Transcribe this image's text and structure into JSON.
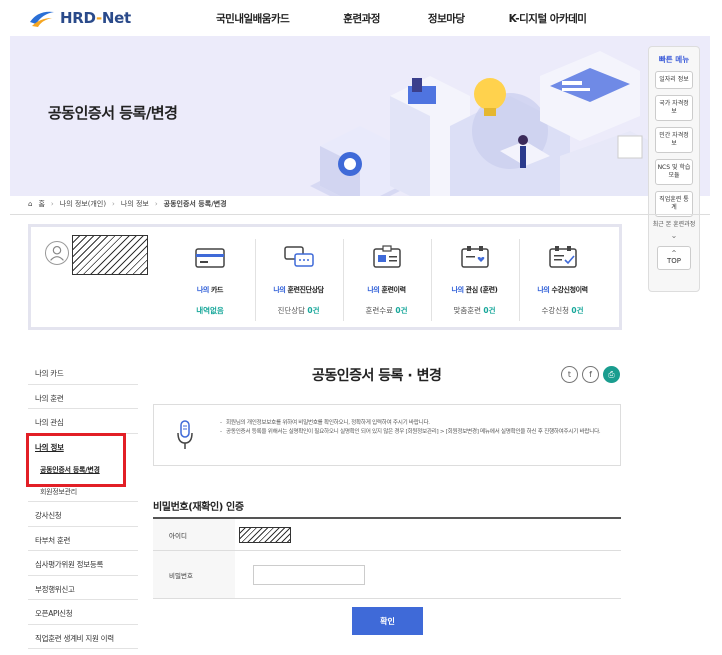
{
  "header": {
    "logo_main": "HRD",
    "logo_dash": "-",
    "logo_sub": "Net",
    "nav": [
      "국민내일배움카드",
      "훈련과정",
      "정보마당",
      "K-디지털 아카데미"
    ]
  },
  "hero": {
    "title": "공동인증서 등록/변경"
  },
  "quick_menu": {
    "title": "빠른 메뉴",
    "buttons": [
      "일자리 정보",
      "국가 자격정보",
      "민간 자격정보",
      "NCS 및 학습모듈",
      "직업훈련 통계"
    ],
    "recent": "최근 본 훈련과정",
    "top": "TOP"
  },
  "breadcrumb": [
    "홈",
    "나의 정보(개인)",
    "나의 정보",
    "공동인증서 등록/변경"
  ],
  "summary": {
    "items": [
      {
        "label_b": "나의",
        "label": " 카드",
        "value_plain": "내역없음"
      },
      {
        "label_b": "나의",
        "label": " 훈련진단상담",
        "value_text": "진단상담 ",
        "value_num": "0건"
      },
      {
        "label_b": "나의",
        "label": " 훈련이력",
        "value_text": "훈련수료 ",
        "value_num": "0건"
      },
      {
        "label_b": "나의",
        "label": " 관심 (훈련)",
        "value_text": "맞춤훈련 ",
        "value_num": "0건"
      },
      {
        "label_b": "나의",
        "label": " 수강신청이력",
        "value_text": "수강신청 ",
        "value_num": "0건"
      }
    ]
  },
  "side_menu": {
    "items_top": [
      "나의 카드",
      "나의 훈련",
      "나의 관심"
    ],
    "active": "나의 정보",
    "sub_on": "공동인증서 등록/변경",
    "sub_off": "회원정보관리",
    "items_bottom": [
      "강사신청",
      "타부처 훈련",
      "심사평가위원 정보등록",
      "부정행위신고",
      "오픈API신청",
      "직업훈련 생계비 지원 이력"
    ]
  },
  "content": {
    "title": "공동인증서 등록 · 변경",
    "notice": [
      "회원님의 개인정보보호를 위하여 비밀번호를 확인하오니, 정확하게 입력하여 주시기 바랍니다.",
      "공동인증서 등록을 위해서는 실명확인이 필요하오니 실명확인 되어 있지 않은 경우 [회원정보관리] > [회원정보변경] 메뉴에서 실명확인을 하신 후 진행하여주시기 바랍니다."
    ],
    "auth_title": "비밀번호(재확인) 인증",
    "id_label": "아이디",
    "pw_label": "비밀번호",
    "pw_value": "",
    "confirm": "확인"
  },
  "colors": {
    "brand_blue": "#3f6ad8",
    "teal": "#17a79a",
    "highlight_red": "#e21f26",
    "hero_bg": "#ecebfa"
  }
}
